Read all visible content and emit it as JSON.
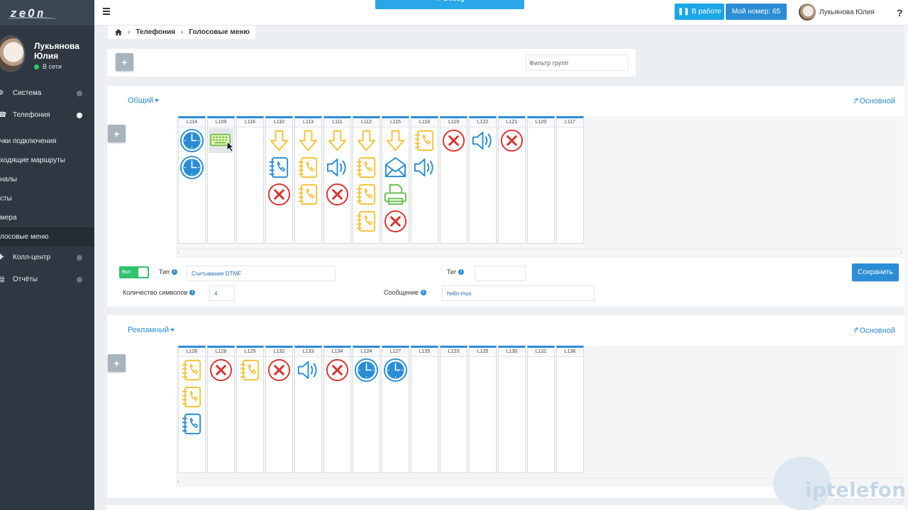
{
  "app": {
    "logo_text": "zeOn"
  },
  "sidebar": {
    "user_name": "Лукьянова Юлия",
    "user_status": "В сети",
    "items": [
      {
        "label": "Система",
        "icon": "cogs-icon"
      },
      {
        "label": "Телефония",
        "icon": "phone-icon"
      }
    ],
    "sub_items": [
      {
        "label": "чки подключения"
      },
      {
        "label": "ходящие маршруты"
      },
      {
        "label": "налы"
      },
      {
        "label": "сты"
      },
      {
        "label": "мера"
      },
      {
        "label": "лосовые меню"
      }
    ],
    "bottom_items": [
      {
        "label": "Колл-центр",
        "icon": "users-icon"
      },
      {
        "label": "Отчёты",
        "icon": "report-icon"
      }
    ]
  },
  "topbar": {
    "debug_label": "★ Debug",
    "work_label": "В работе",
    "number_label": "Мой номер: 65",
    "user_name": "Лукьянова Юлия",
    "help": "?"
  },
  "breadcrumb": {
    "home_icon": "home-icon",
    "items": [
      "Телефония",
      "Голосовые меню"
    ]
  },
  "filter": {
    "placeholder": "Фильтр групп",
    "add_label": "+"
  },
  "groups": [
    {
      "title": "Общий",
      "link": "Основной",
      "add_label": "+",
      "columns": [
        {
          "label": "L114",
          "icons": [
            "clock",
            "clock"
          ]
        },
        {
          "label": "L109",
          "icons": [
            "keyboard"
          ]
        },
        {
          "label": "L116",
          "icons": []
        },
        {
          "label": "L110",
          "icons": [
            "arrow-down",
            "notebook-blue",
            "hangup"
          ]
        },
        {
          "label": "L113",
          "icons": [
            "arrow-down",
            "notebook-yellow",
            "notebook-yellow"
          ]
        },
        {
          "label": "L111",
          "icons": [
            "arrow-down",
            "speaker",
            "hangup"
          ]
        },
        {
          "label": "L112",
          "icons": [
            "arrow-down",
            "notebook-yellow",
            "notebook-yellow",
            "notebook-yellow"
          ]
        },
        {
          "label": "L115",
          "icons": [
            "arrow-down",
            "envelope",
            "fax",
            "hangup"
          ]
        },
        {
          "label": "L118",
          "icons": [
            "notebook-yellow",
            "speaker"
          ]
        },
        {
          "label": "L119",
          "icons": [
            "hangup"
          ]
        },
        {
          "label": "L122",
          "icons": [
            "speaker"
          ]
        },
        {
          "label": "L121",
          "icons": [
            "hangup"
          ]
        },
        {
          "label": "L120",
          "icons": []
        },
        {
          "label": "L117",
          "icons": []
        }
      ],
      "settings": {
        "toggle_label": "Вкл",
        "type_label": "Тип",
        "type_value": "Считывание DTMF",
        "tag_label": "Тег",
        "tag_value": "",
        "count_label": "Количество символов",
        "count_value": "4",
        "message_label": "Сообщение",
        "message_value": "hello-mus",
        "save_label": "Сохранить"
      }
    },
    {
      "title": "Рекламный",
      "link": "Основной",
      "add_label": "+",
      "columns": [
        {
          "label": "L126",
          "icons": [
            "notebook-yellow",
            "notebook-yellow",
            "notebook-blue"
          ]
        },
        {
          "label": "L128",
          "icons": [
            "hangup"
          ]
        },
        {
          "label": "L129",
          "icons": [
            "notebook-yellow"
          ]
        },
        {
          "label": "L132",
          "icons": [
            "hangup"
          ]
        },
        {
          "label": "L133",
          "icons": [
            "speaker"
          ]
        },
        {
          "label": "L134",
          "icons": [
            "hangup"
          ]
        },
        {
          "label": "L124",
          "icons": [
            "clock"
          ]
        },
        {
          "label": "L127",
          "icons": [
            "clock"
          ]
        },
        {
          "label": "L135",
          "icons": []
        },
        {
          "label": "L123",
          "icons": []
        },
        {
          "label": "L125",
          "icons": []
        },
        {
          "label": "L130",
          "icons": []
        },
        {
          "label": "L131",
          "icons": []
        },
        {
          "label": "L136",
          "icons": []
        }
      ]
    }
  ],
  "watermark": "iptelefon.r",
  "colors": {
    "accent": "#2b8dd6",
    "sidebar": "#2f3842",
    "yellow": "#f5c23a",
    "red": "#d9322f",
    "green": "#6bbf4e",
    "toggle": "#2fc26f"
  }
}
